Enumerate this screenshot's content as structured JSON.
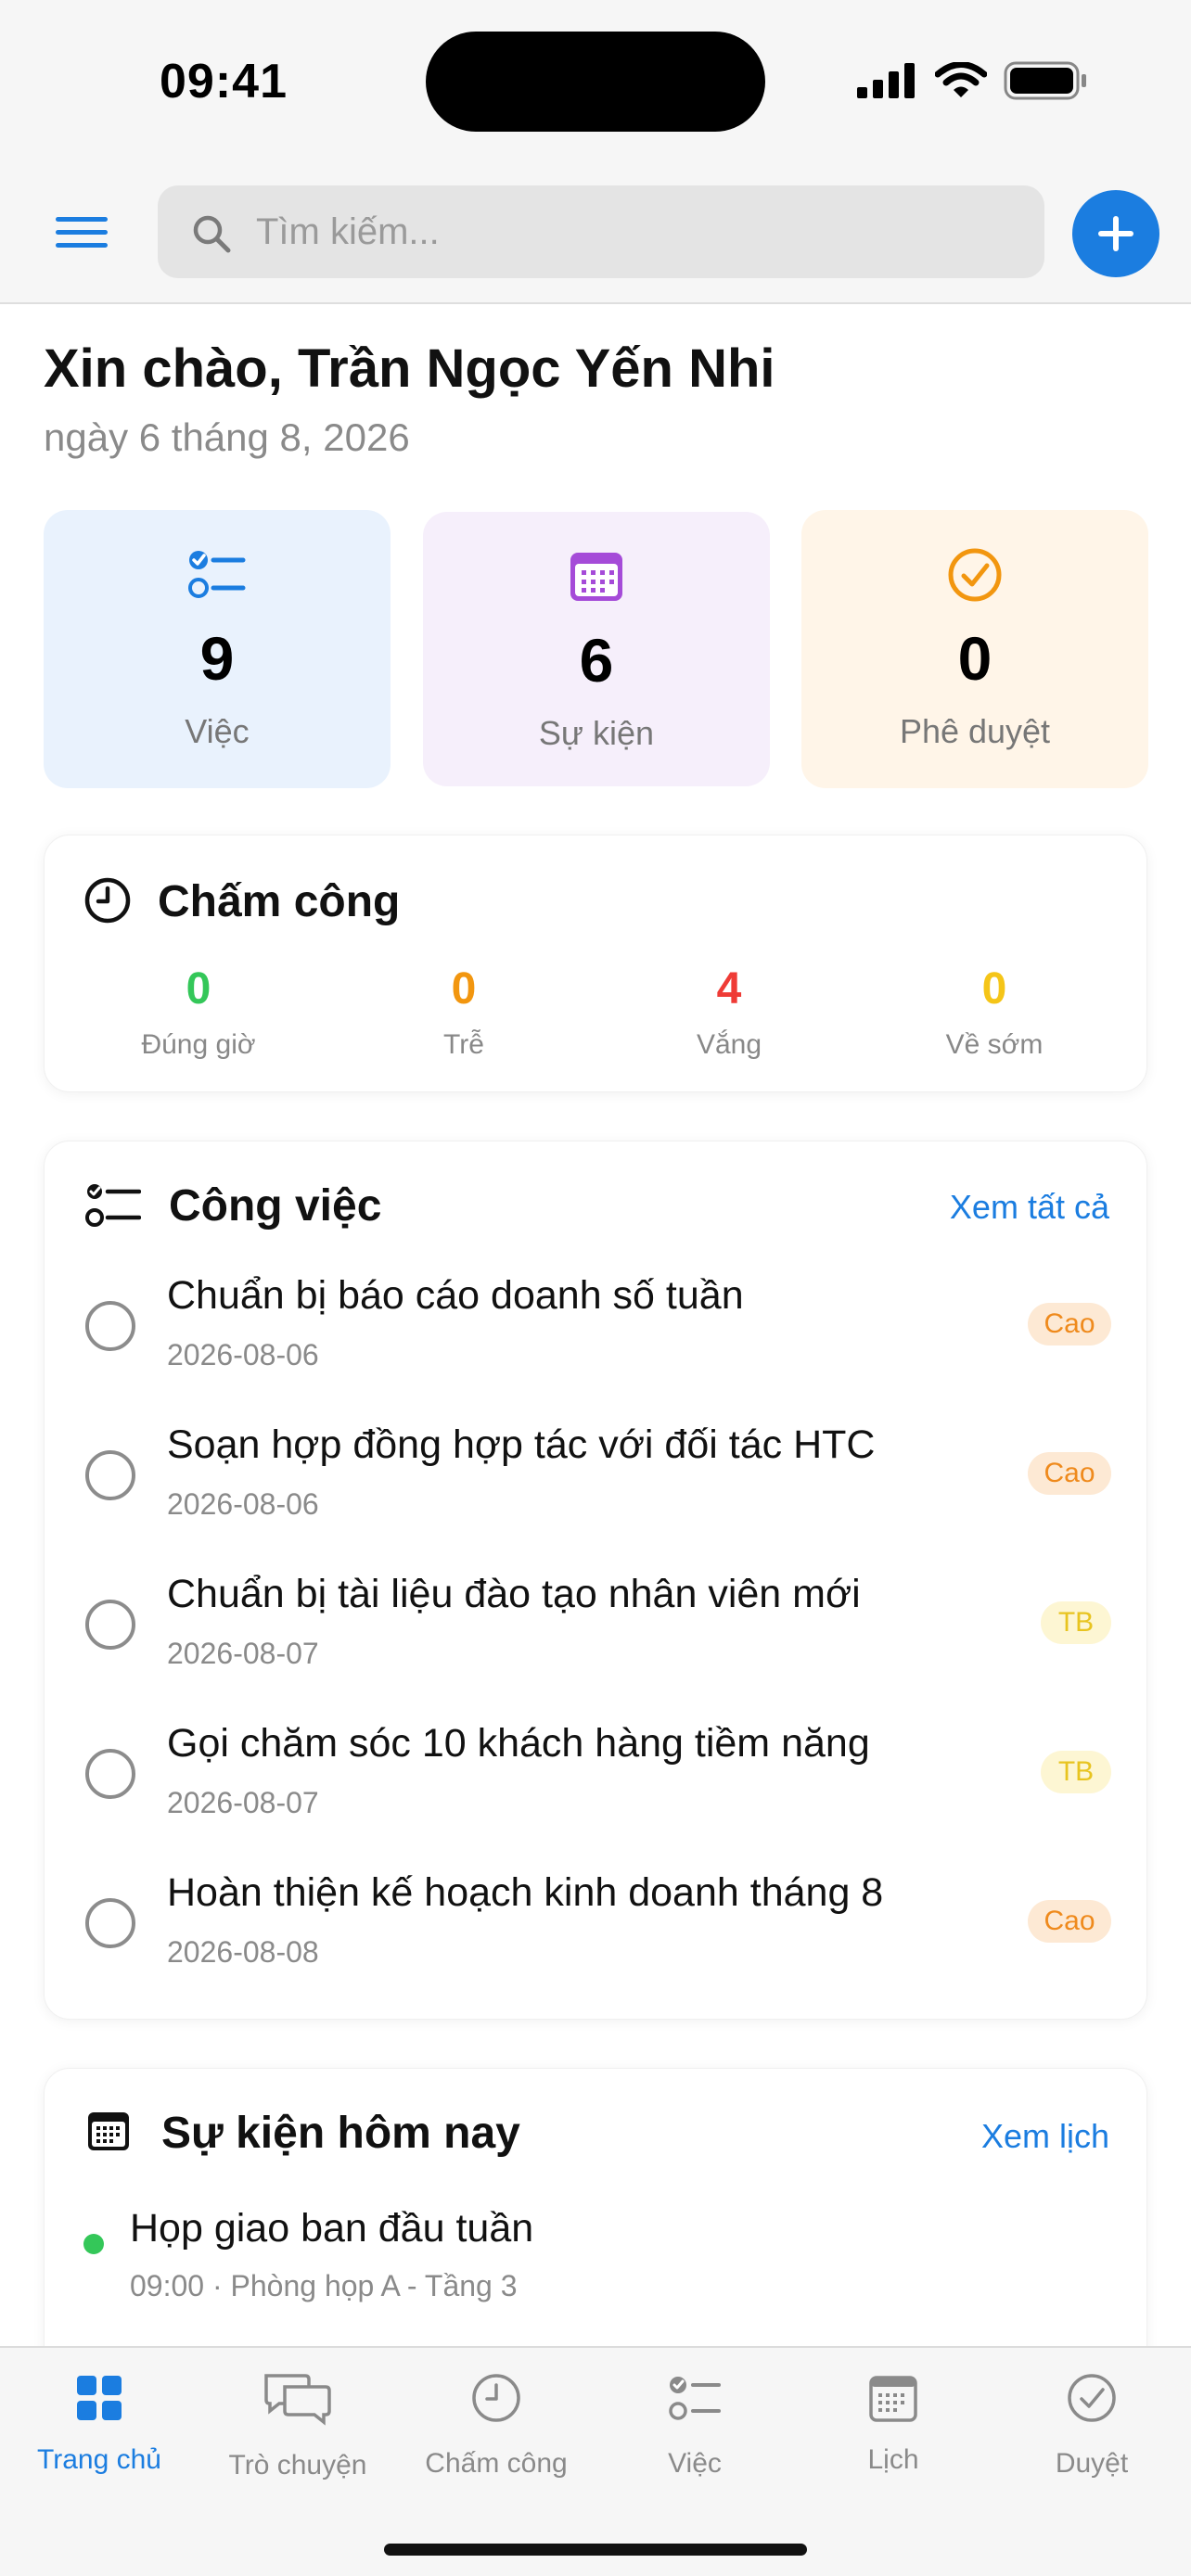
{
  "status_bar": {
    "time": "09:41"
  },
  "search": {
    "placeholder": "Tìm kiếm..."
  },
  "greeting": {
    "title": "Xin chào, Trần Ngọc Yến Nhi",
    "date": "ngày 6 tháng 8, 2026"
  },
  "stats": [
    {
      "value": "9",
      "label": "Việc",
      "icon": "task-list-icon",
      "color": "#1b7de0"
    },
    {
      "value": "6",
      "label": "Sự kiện",
      "icon": "calendar-icon",
      "color": "#a54bd8"
    },
    {
      "value": "0",
      "label": "Phê duyệt",
      "icon": "check-circle-icon",
      "color": "#f2960f"
    }
  ],
  "attendance": {
    "title": "Chấm công",
    "items": [
      {
        "value": "0",
        "label": "Đúng giờ",
        "color": "#34c759"
      },
      {
        "value": "0",
        "label": "Trễ",
        "color": "#f2960f"
      },
      {
        "value": "4",
        "label": "Vắng",
        "color": "#ef3b36"
      },
      {
        "value": "0",
        "label": "Về sớm",
        "color": "#f5c518"
      }
    ]
  },
  "tasks": {
    "title": "Công việc",
    "see_all": "Xem tất cả",
    "items": [
      {
        "title": "Chuẩn bị báo cáo doanh số tuần",
        "date": "2026-08-06",
        "priority": "Cao"
      },
      {
        "title": "Soạn hợp đồng hợp tác với đối tác HTC",
        "date": "2026-08-06",
        "priority": "Cao"
      },
      {
        "title": "Chuẩn bị tài liệu đào tạo nhân viên mới",
        "date": "2026-08-07",
        "priority": "TB"
      },
      {
        "title": "Gọi chăm sóc 10 khách hàng tiềm năng",
        "date": "2026-08-07",
        "priority": "TB"
      },
      {
        "title": "Hoàn thiện kế hoạch kinh doanh tháng 8",
        "date": "2026-08-08",
        "priority": "Cao"
      }
    ]
  },
  "events": {
    "title": "Sự kiện hôm nay",
    "see_calendar": "Xem lịch",
    "items": [
      {
        "title": "Họp giao ban đầu tuần",
        "meta": "09:00 · Phòng họp A - Tầng 3"
      }
    ]
  },
  "tabbar": {
    "items": [
      {
        "label": "Trang chủ",
        "icon": "home-grid-icon",
        "active": true
      },
      {
        "label": "Trò chuyện",
        "icon": "chat-icon",
        "active": false
      },
      {
        "label": "Chấm công",
        "icon": "clock-icon",
        "active": false
      },
      {
        "label": "Việc",
        "icon": "task-list-icon",
        "active": false
      },
      {
        "label": "Lịch",
        "icon": "calendar-icon",
        "active": false
      },
      {
        "label": "Duyệt",
        "icon": "check-circle-icon",
        "active": false
      }
    ]
  }
}
